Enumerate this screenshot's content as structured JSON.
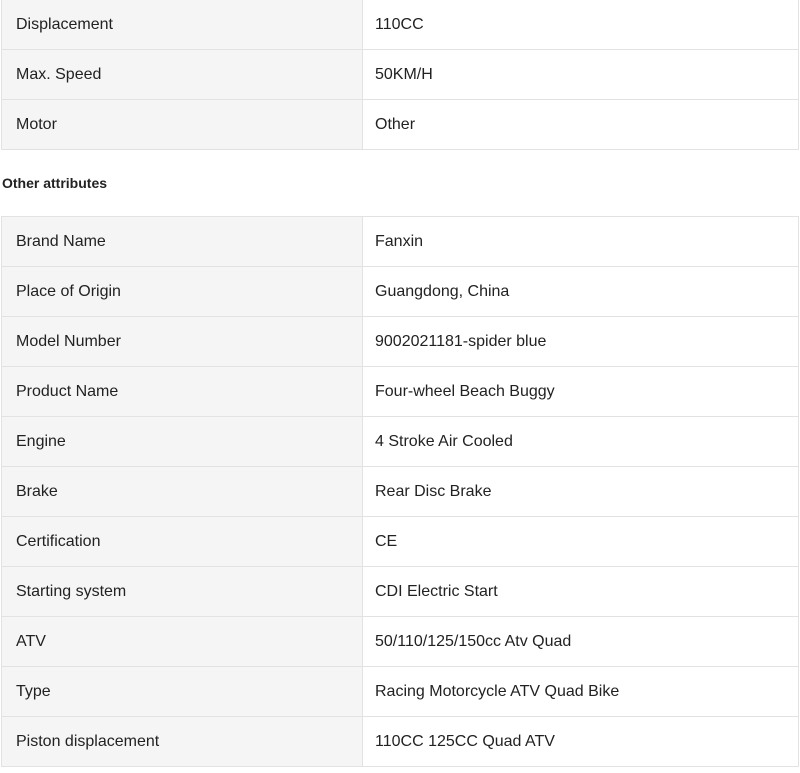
{
  "top_attributes": [
    {
      "key": "Displacement",
      "value": "110CC"
    },
    {
      "key": "Max. Speed",
      "value": "50KM/H"
    },
    {
      "key": "Motor",
      "value": "Other"
    }
  ],
  "section_title": "Other attributes",
  "other_attributes": [
    {
      "key": "Brand Name",
      "value": "Fanxin"
    },
    {
      "key": "Place of Origin",
      "value": "Guangdong, China"
    },
    {
      "key": "Model Number",
      "value": "9002021181-spider blue"
    },
    {
      "key": "Product Name",
      "value": "Four-wheel Beach Buggy"
    },
    {
      "key": "Engine",
      "value": "4 Stroke Air Cooled"
    },
    {
      "key": "Brake",
      "value": "Rear Disc Brake"
    },
    {
      "key": "Certification",
      "value": "CE"
    },
    {
      "key": "Starting system",
      "value": "CDI Electric Start"
    },
    {
      "key": "ATV",
      "value": "50/110/125/150cc Atv Quad"
    },
    {
      "key": "Type",
      "value": "Racing Motorcycle ATV Quad Bike"
    },
    {
      "key": "Piston displacement",
      "value": "110CC 125CC Quad ATV"
    }
  ],
  "colors": {
    "key_bg": "#f5f5f5",
    "border": "#e2e2e2",
    "text": "#222222"
  }
}
